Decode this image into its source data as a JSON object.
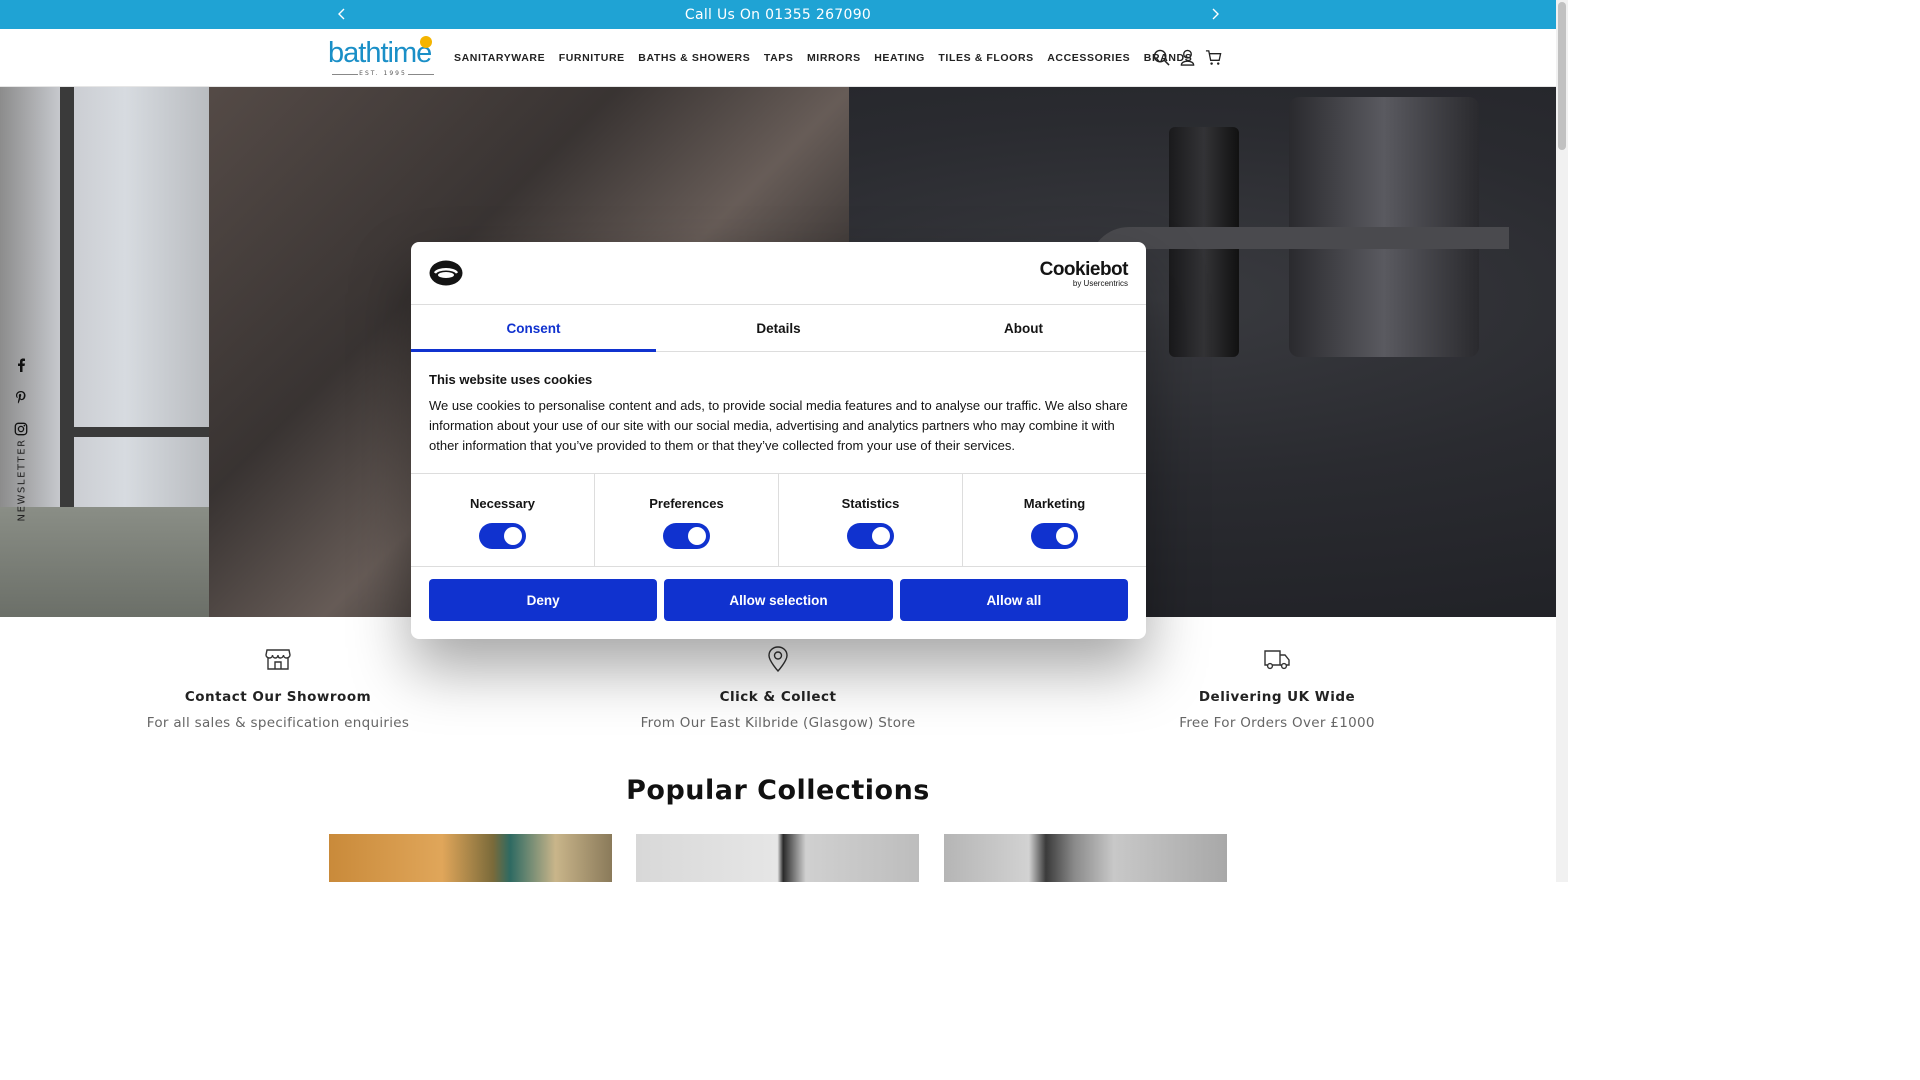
{
  "announcement": {
    "text": "Call Us On 01355 267090"
  },
  "logo": {
    "word": "bathtime",
    "est": "EST. 1995"
  },
  "nav": {
    "items": [
      "SANITARYWARE",
      "FURNITURE",
      "BATHS & SHOWERS",
      "TAPS",
      "MIRRORS",
      "HEATING",
      "TILES & FLOORS",
      "ACCESSORIES",
      "BRANDS"
    ]
  },
  "header_icons": [
    "search-icon",
    "account-icon",
    "cart-icon"
  ],
  "social": {
    "items": [
      "facebook-icon",
      "pinterest-icon",
      "instagram-icon"
    ],
    "newsletter": "NEWSLETTER"
  },
  "features": [
    {
      "icon": "store-icon",
      "title": "Contact Our Showroom",
      "subtitle": "For all sales & specification enquiries"
    },
    {
      "icon": "location-pin-icon",
      "title": "Click & Collect",
      "subtitle": "From Our East Kilbride (Glasgow) Store"
    },
    {
      "icon": "delivery-truck-icon",
      "title": "Delivering UK Wide",
      "subtitle": "Free For Orders Over £1000"
    }
  ],
  "collections": {
    "title": "Popular Collections"
  },
  "cookie": {
    "brand": "Cookiebot",
    "brand_sub": "by Usercentrics",
    "tabs": [
      "Consent",
      "Details",
      "About"
    ],
    "active_tab": "Consent",
    "heading": "This website uses cookies",
    "text": "We use cookies to personalise content and ads, to provide social media features and to analyse our traffic. We also share information about your use of our site with our social media, advertising and analytics partners who may combine it with other information that you’ve provided to them or that they’ve collected from your use of their services.",
    "toggles": [
      {
        "label": "Necessary",
        "on": true
      },
      {
        "label": "Preferences",
        "on": true
      },
      {
        "label": "Statistics",
        "on": true
      },
      {
        "label": "Marketing",
        "on": true
      }
    ],
    "buttons": {
      "deny": "Deny",
      "allow_selection": "Allow selection",
      "allow_all": "Allow all"
    },
    "accent": "#1032cf"
  },
  "colors": {
    "announce_bg": "#1fa3d4",
    "logo_blue": "#1a8fc7",
    "logo_sun": "#f4b400"
  }
}
